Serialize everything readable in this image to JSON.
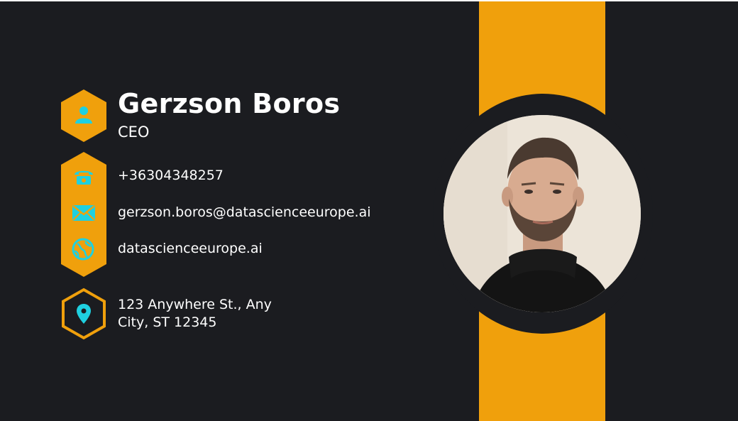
{
  "profile": {
    "name": "Gerzson Boros",
    "title": "CEO"
  },
  "contacts": {
    "phone": "+36304348257",
    "email": "gerzson.boros@datascienceeurope.ai",
    "website": "datascienceeurope.ai"
  },
  "address": {
    "line1": "123 Anywhere St., Any",
    "line2": "City, ST 12345"
  },
  "icons": {
    "profile": "user-icon",
    "phone": "phone-icon",
    "email": "envelope-icon",
    "website": "globe-icon",
    "address": "map-pin-icon"
  },
  "colors": {
    "background": "#1b1c20",
    "accent": "#f0a00c",
    "icon": "#1fd0e0",
    "text": "#ffffff"
  }
}
